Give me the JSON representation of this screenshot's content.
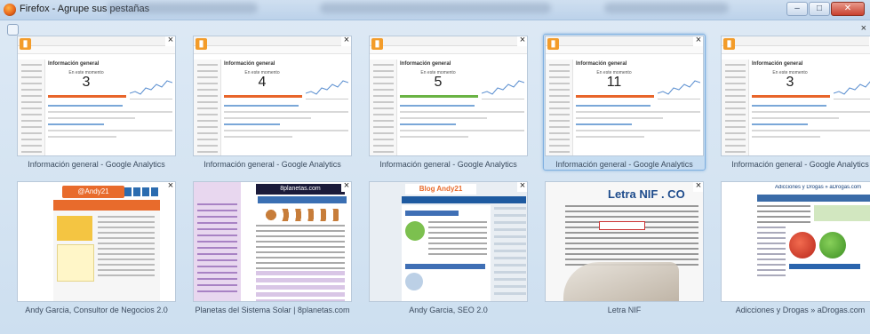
{
  "window": {
    "title": "Firefox - Agrupe sus pestañas",
    "close_glyph": "×"
  },
  "tabs": [
    {
      "caption": "Información general - Google Analytics",
      "kind": "ga",
      "visitors_now": "3",
      "header": "Información general",
      "label": "En este momento",
      "selected": false
    },
    {
      "caption": "Información general - Google Analytics",
      "kind": "ga",
      "visitors_now": "4",
      "header": "Información general",
      "label": "En este momento",
      "selected": false
    },
    {
      "caption": "Información general - Google Analytics",
      "kind": "ga",
      "visitors_now": "5",
      "header": "Información general",
      "label": "En este momento",
      "selected": false
    },
    {
      "caption": "Información general - Google Analytics",
      "kind": "ga",
      "visitors_now": "11",
      "header": "Información general",
      "label": "En este momento",
      "selected": true
    },
    {
      "caption": "Información general - Google Analytics",
      "kind": "ga",
      "visitors_now": "3",
      "header": "Información general",
      "label": "En este momento",
      "selected": false
    },
    {
      "caption": "Andy Garcia, Consultor de Negocios 2.0",
      "kind": "andy",
      "site_title": "@Andy21",
      "selected": false
    },
    {
      "caption": "Planetas del Sistema Solar | 8planetas.com",
      "kind": "planets",
      "site_title": "8planetas.com",
      "selected": false
    },
    {
      "caption": "Andy Garcia, SEO 2.0",
      "kind": "seo",
      "site_title": "Blog Andy21",
      "selected": false
    },
    {
      "caption": "Letra NIF",
      "kind": "nif",
      "site_title": "Letra NIF . CO",
      "selected": false
    },
    {
      "caption": "Adicciones y Drogas » aDrogas.com",
      "kind": "drogas",
      "site_title": "Adicciones y Drogas » aDrogas.com",
      "selected": false
    }
  ]
}
